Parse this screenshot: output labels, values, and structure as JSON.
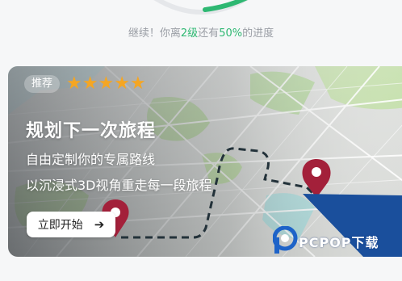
{
  "progress": {
    "percent": 50,
    "prefix": "继续！你离",
    "level_value": "2级",
    "middle": "还有",
    "percent_label": "50%",
    "suffix": "的进度",
    "ring_color": "#2eb872"
  },
  "card": {
    "badge": "推荐",
    "rating": 5,
    "title": "规划下一次旅程",
    "line1": "自由定制你的专属路线",
    "line2": "以沉浸式3D视角重走每一段旅程",
    "button_label": "立即开始",
    "button_icon": "arrow-right-icon",
    "star_color": "#f5a623",
    "pin_color": "#a3203a"
  },
  "watermark": {
    "text": "PCPOP下载"
  }
}
